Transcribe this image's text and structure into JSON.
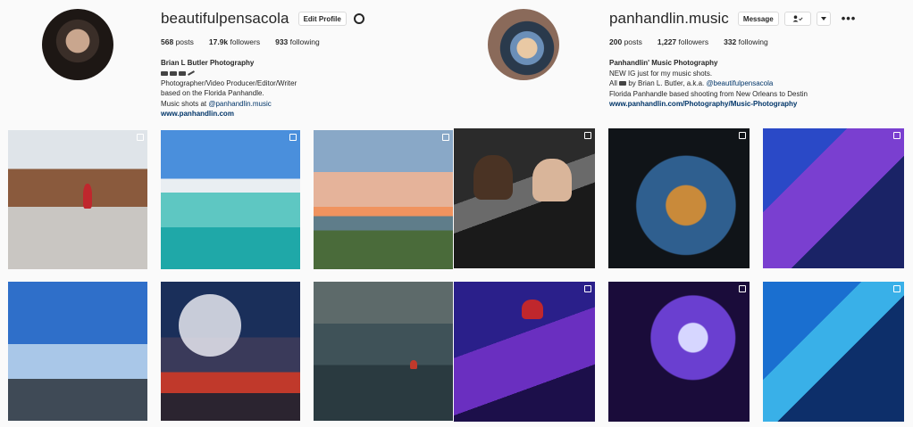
{
  "left": {
    "username": "beautifulpensacola",
    "edit_profile_label": "Edit Profile",
    "settings_icon": "gear-icon",
    "stats": {
      "posts_count": "568",
      "posts_label": "posts",
      "followers_count": "17.9k",
      "followers_label": "followers",
      "following_count": "933",
      "following_label": "following"
    },
    "bio": {
      "name": "Brian L Butler Photography",
      "line1": "Photographer/Video Producer/Editor/Writer",
      "line2": "based on the Florida Panhandle.",
      "line3_prefix": "Music shots at ",
      "line3_mention": "@panhandlin.music",
      "website": "www.panhandlin.com"
    }
  },
  "right": {
    "username": "panhandlin.music",
    "message_label": "Message",
    "following_icon": "person-check-icon",
    "dropdown_icon": "chevron-down-icon",
    "more_label": "•••",
    "stats": {
      "posts_count": "200",
      "posts_label": "posts",
      "followers_count": "1,227",
      "followers_label": "followers",
      "following_count": "332",
      "following_label": "following"
    },
    "bio": {
      "name": "Panhandlin' Music Photography",
      "line1": "NEW IG just for my music shots.",
      "line2_prefix": "All ",
      "line2_middle": " by Brian L. Butler, a.k.a. ",
      "line2_mention": "@beautifulpensacola",
      "line3": "Florida Panhandle based shooting from New Orleans to Destin",
      "website": "www.panhandlin.com/Photography/Music-Photography"
    }
  },
  "grid": {
    "left_tiles": [
      "beach-wreck",
      "beach-pier",
      "sunset-beach",
      "sunset-pier",
      "fish-house-sign",
      "surfer-wave"
    ],
    "right_tiles": [
      "rappers-duo",
      "guitarist-sunglasses",
      "band-stage-blue",
      "singer-red-beanie",
      "guitarist-woman",
      "singer-mic-blue"
    ]
  }
}
